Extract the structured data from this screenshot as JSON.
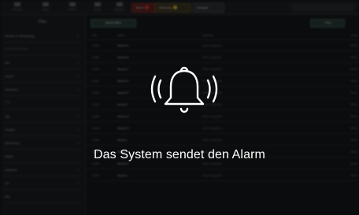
{
  "caption": "Das System sendet den Alarm",
  "bell_icon": "bell-ringing-icon",
  "colors": {
    "background": "#0f1113",
    "overlay": "rgba(0,0,0,0.47)",
    "caption": "#ffffff",
    "alarm_red": "#d23b3b",
    "warning_amber": "#d9b533"
  },
  "topbar": {
    "nav": [
      {
        "icon": "grid-icon",
        "label": "Übersicht"
      },
      {
        "icon": "chart-icon",
        "label": "Alarm"
      },
      {
        "icon": "list-icon",
        "label": "Bericht"
      },
      {
        "icon": "gear-icon",
        "label": "Geräte"
      },
      {
        "icon": "user-icon",
        "label": "Benutzer"
      }
    ],
    "chips": {
      "alarm": "Alarm",
      "warning": "Warnung",
      "other": "Ereignis"
    }
  },
  "sidebar": {
    "title": "Filter",
    "rows": [
      {
        "text": "Geräte im Monitoring",
        "count": "5"
      },
      {
        "text": "Alarm-Status Filter",
        "count": "",
        "section": true
      },
      {
        "text": "Alle",
        "count": "1"
      },
      {
        "text": "Zonen",
        "count": "2"
      },
      {
        "text": "Sensoren",
        "count": "3"
      },
      {
        "text": "Filter",
        "count": "",
        "section": true
      },
      {
        "text": "Typ",
        "count": "1"
      },
      {
        "text": "Gruppe",
        "count": "2"
      },
      {
        "text": "Monitoring",
        "count": "3"
      },
      {
        "text": "Status",
        "count": ""
      },
      {
        "text": "Zeitraum",
        "count": "1"
      },
      {
        "text": "Ort",
        "count": "2"
      },
      {
        "text": "Alle",
        "count": ""
      }
    ]
  },
  "main": {
    "filter_button": "Alarme filtern",
    "new_button": "+ Neu",
    "columns": [
      "Zeit",
      "Name",
      "Meldung",
      "Ende"
    ],
    "rows": [
      {
        "time": "12:04",
        "name": "Sensor A",
        "msg": "Alarm ausgelöst",
        "end": "09:11"
      },
      {
        "time": "12:04",
        "name": "Sensor B",
        "msg": "Alarm ausgelöst",
        "end": "09:11"
      },
      {
        "time": "12:04",
        "name": "Sensor C",
        "msg": "Alarm ausgelöst",
        "end": "09:11"
      },
      {
        "time": "12:04",
        "name": "Sensor D",
        "msg": "Alarm ausgelöst",
        "end": "09:11"
      },
      {
        "time": "12:04",
        "name": "Sensor E",
        "msg": "Alarm ausgelöst",
        "end": "09:11"
      },
      {
        "time": "12:04",
        "name": "Sensor F",
        "msg": "Alarm ausgelöst",
        "end": "09:11"
      },
      {
        "time": "12:04",
        "name": "Sensor G",
        "msg": "Alarm ausgelöst",
        "end": "09:11"
      },
      {
        "time": "12:04",
        "name": "Sensor H",
        "msg": "Alarm ausgelöst",
        "end": "09:11"
      },
      {
        "time": "12:04",
        "name": "Sensor I",
        "msg": "Alarm ausgelöst",
        "end": "09:11"
      },
      {
        "time": "12:04",
        "name": "Sensor J",
        "msg": "Alarm ausgelöst",
        "end": "09:11"
      },
      {
        "time": "12:04",
        "name": "Sensor K",
        "msg": "Alarm ausgelöst",
        "end": "09:11"
      },
      {
        "time": "12:04",
        "name": "Sensor L",
        "msg": "Alarm ausgelöst",
        "end": "09:11"
      }
    ]
  }
}
